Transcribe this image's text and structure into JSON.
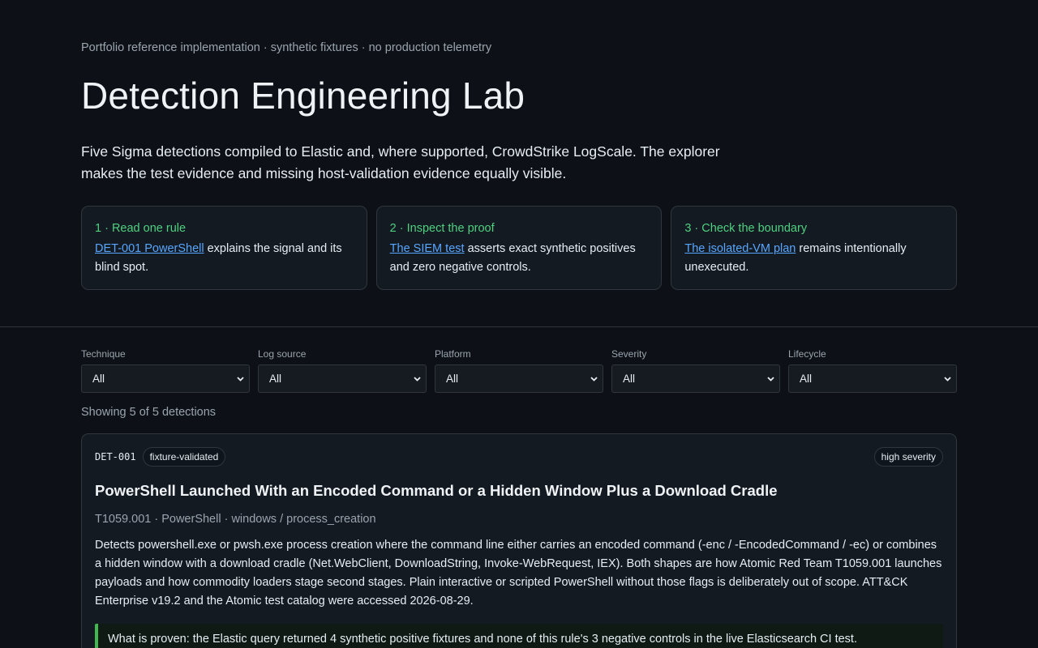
{
  "hero": {
    "eyebrow": "Portfolio reference implementation · synthetic fixtures · no production telemetry",
    "title": "Detection Engineering Lab",
    "lede": "Five Sigma detections compiled to Elastic and, where supported, CrowdStrike LogScale. The explorer makes the test evidence and missing host-validation evidence equally visible."
  },
  "steps": [
    {
      "head": "1 · Read one rule",
      "link": "DET-001 PowerShell",
      "rest": " explains the signal and its blind spot."
    },
    {
      "head": "2 · Inspect the proof",
      "link": "The SIEM test",
      "rest": " asserts exact synthetic positives and zero negative controls."
    },
    {
      "head": "3 · Check the boundary",
      "link": "The isolated-VM plan",
      "rest": " remains intentionally unexecuted."
    }
  ],
  "filters": [
    {
      "label": "Technique",
      "value": "All"
    },
    {
      "label": "Log source",
      "value": "All"
    },
    {
      "label": "Platform",
      "value": "All"
    },
    {
      "label": "Severity",
      "value": "All"
    },
    {
      "label": "Lifecycle",
      "value": "All"
    }
  ],
  "count_text": "Showing 5 of 5 detections",
  "detections": [
    {
      "id": "DET-001",
      "status": "fixture-validated",
      "severity": "high severity",
      "title": "PowerShell Launched With an Encoded Command or a Hidden Window Plus a Download Cradle",
      "meta": "T1059.001 · PowerShell · windows / process_creation",
      "description": "Detects powershell.exe or pwsh.exe process creation where the command line either carries an encoded command (-enc / -EncodedCommand / -ec) or combines a hidden window with a download cradle (Net.WebClient, DownloadString, Invoke-WebRequest, IEX). Both shapes are how Atomic Red Team T1059.001 launches payloads and how commodity loaders stage second stages. Plain interactive or scripted PowerShell without those flags is deliberately out of scope. ATT&CK Enterprise v19.2 and the Atomic test catalog were accessed 2026-08-29.",
      "proof": "What is proven: the Elastic query returned 4 synthetic positive fixtures and none of this rule's 3 negative controls in the live Elasticsearch CI test."
    }
  ],
  "colors": {
    "accent_green": "#4fd17f",
    "link_blue": "#58a6ff",
    "background": "#0d1117"
  },
  "icons": {
    "select_chevron": "chevron-down-icon"
  }
}
